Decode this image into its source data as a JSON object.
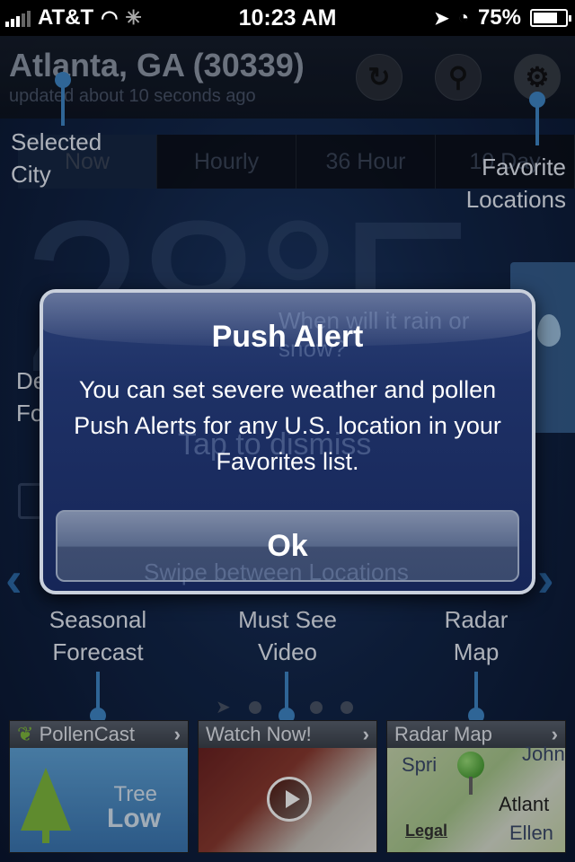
{
  "status_bar": {
    "carrier": "AT&T",
    "time": "10:23 AM",
    "battery": "75%",
    "battery_level": 0.75
  },
  "header": {
    "city": "Atlanta, GA (30339)",
    "updated": "updated about 10 seconds ago"
  },
  "tabs": [
    {
      "label": "Now"
    },
    {
      "label": "Hourly"
    },
    {
      "label": "36 Hour"
    },
    {
      "label": "10 Day"
    }
  ],
  "background": {
    "temperature": "28°F",
    "rain_question": "When will it rain or snow?",
    "dismiss_hint": "Tap to dismiss",
    "swipe_hint": "Swipe between Locations"
  },
  "annotations": {
    "selected_city": "Selected City",
    "favorite_locations": "Favorite Locations",
    "detailed_forecast": "Detailed Forecast",
    "seasonal_forecast": "Seasonal Forecast",
    "must_see_video": "Must See Video",
    "radar_map": "Radar Map"
  },
  "tiles": {
    "pollen": {
      "title": "PollenCast",
      "type": "Tree",
      "level": "Low"
    },
    "video": {
      "title": "Watch Now!"
    },
    "radar": {
      "title": "Radar Map",
      "legal": "Legal",
      "map_labels": [
        "Spri",
        "John",
        "Atlant",
        "Ellen"
      ]
    }
  },
  "alert": {
    "title": "Push Alert",
    "message": "You can set severe weather and pollen Push Alerts for any U.S. location in your Favorites list.",
    "ok_label": "Ok"
  },
  "icons": {
    "refresh": "refresh-icon",
    "search": "search-icon",
    "settings": "gear-icon"
  },
  "colors": {
    "accent": "#3f87c8",
    "alert_bg": "#1e3166"
  }
}
